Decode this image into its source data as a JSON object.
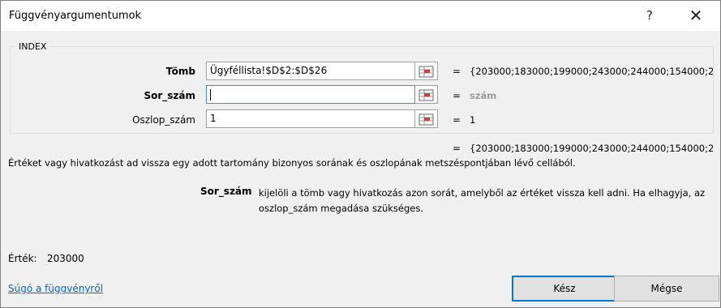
{
  "window": {
    "title": "Függvényargumentumok",
    "help_glyph": "?",
    "close_glyph": "✕"
  },
  "function_name": "INDEX",
  "args": [
    {
      "label": "Tömb",
      "value": "Ügyféllista!$D$2:$D$26",
      "equals": "=",
      "result": "{203000;183000;199000;243000;244000;154000;29"
    },
    {
      "label": "Sor_szám",
      "value": "",
      "equals": "=",
      "result": "szám"
    },
    {
      "label": "Oszlop_szám",
      "value": "1",
      "equals": "=",
      "result": "1"
    }
  ],
  "overall": {
    "equals": "=",
    "result": "{203000;183000;199000;243000;244000;154000;29"
  },
  "description": "Értéket vagy hivatkozást ad vissza egy adott tartomány bizonyos sorának és oszlopának metszéspontjában lévő cellából.",
  "current_arg": {
    "name": "Sor_szám",
    "description": "kijelöli a tömb vagy hivatkozás azon sorát, amelyből az értéket vissza kell adni. Ha elhagyja, az oszlop_szám megadása szükséges."
  },
  "value_label": "Érték:",
  "value": "203000",
  "help_link": "Súgó a függvényről",
  "buttons": {
    "ok": "Kész",
    "cancel": "Mégse"
  }
}
